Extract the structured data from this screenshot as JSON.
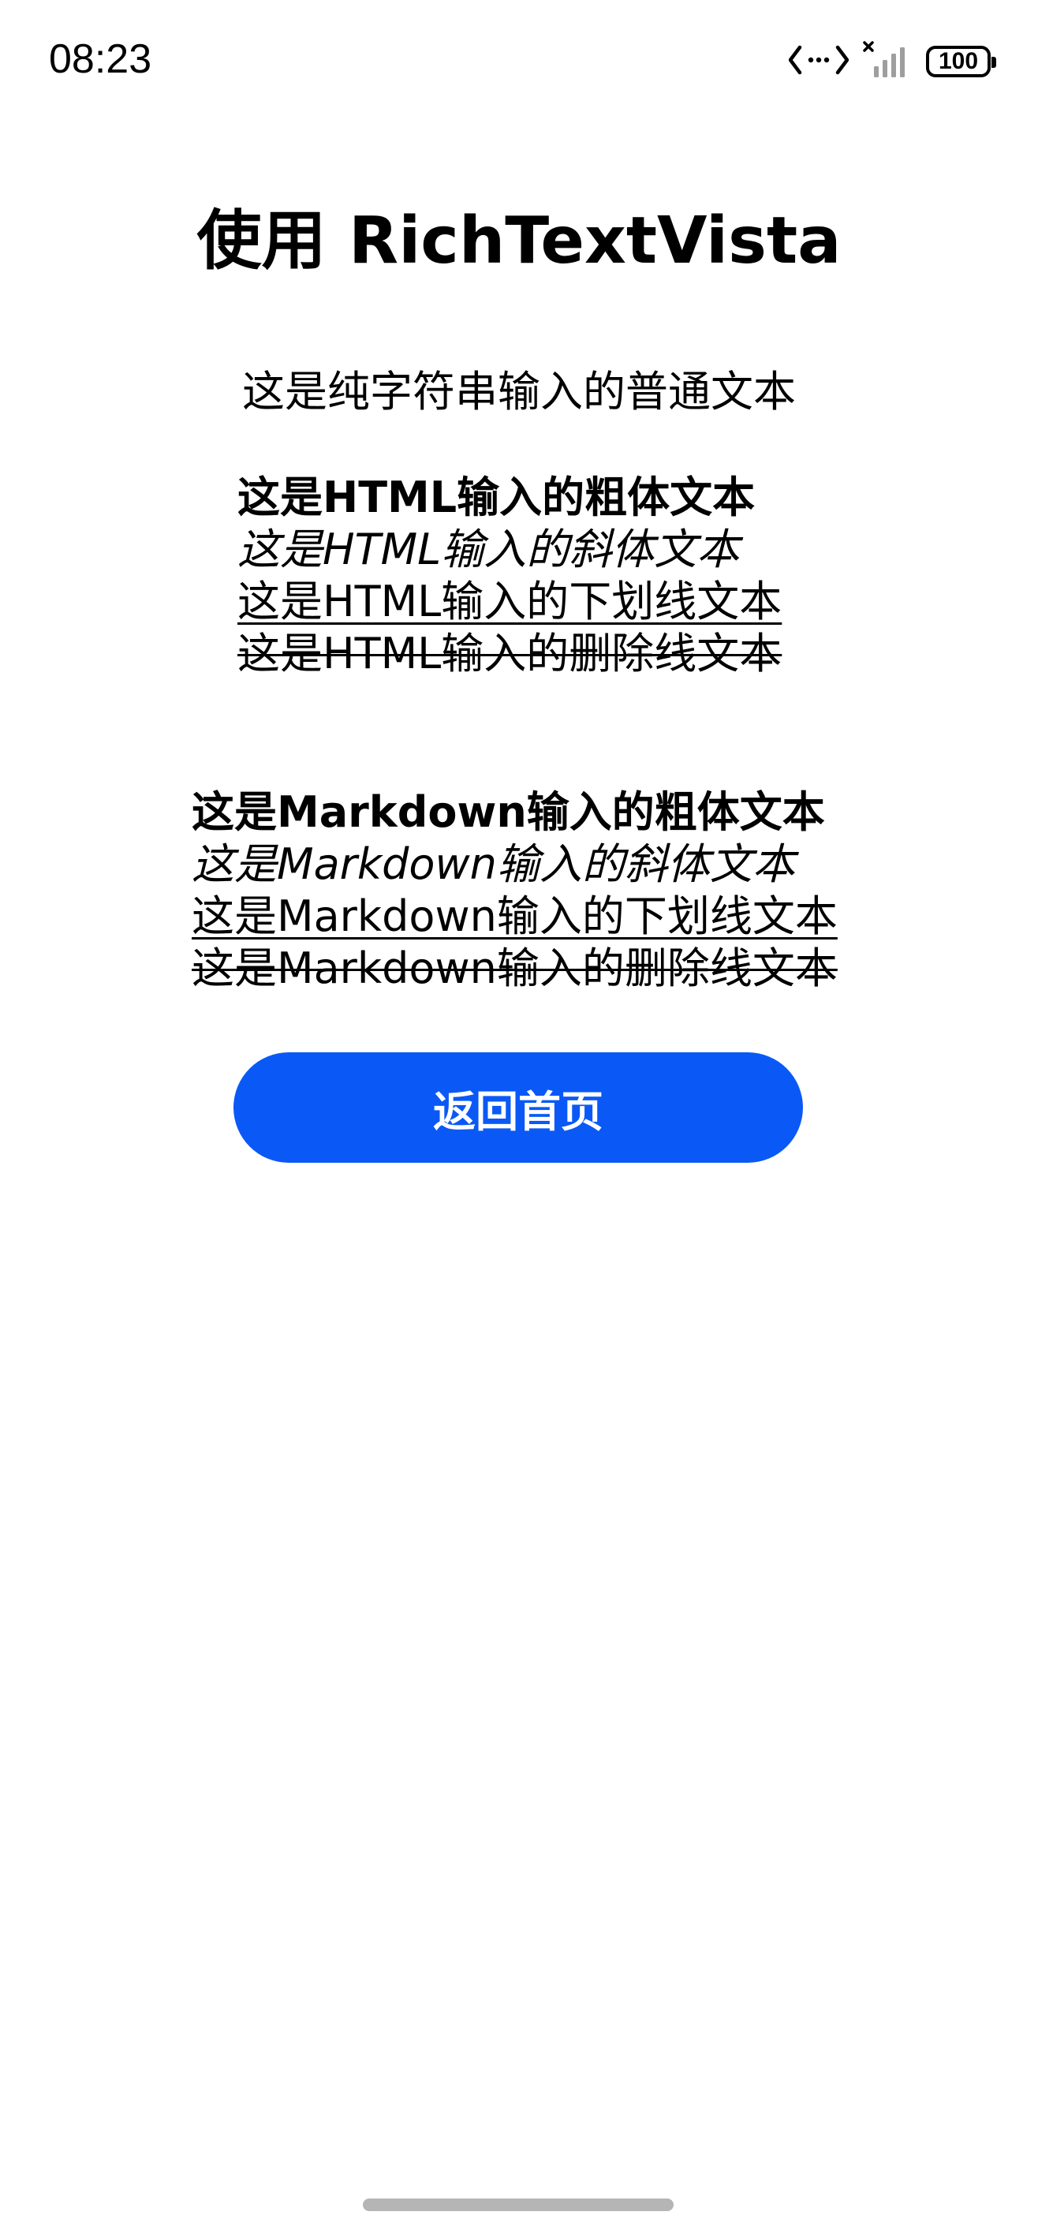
{
  "status_bar": {
    "time": "08:23",
    "battery_level": "100",
    "icons": [
      "data-transfer-icon",
      "no-sim-signal-icon",
      "battery-icon"
    ]
  },
  "page": {
    "title": "使用 RichTextVista",
    "plain_text": "这是纯字符串输入的普通文本",
    "html_lines": {
      "bold": "这是HTML输入的粗体文本",
      "italic": "这是HTML输入的斜体文本",
      "underline": "这是HTML输入的下划线文本",
      "strike": "这是HTML输入的删除线文本"
    },
    "markdown_lines": {
      "bold": "这是Markdown输入的粗体文本",
      "italic": "这是Markdown输入的斜体文本",
      "underline": "这是Markdown输入的下划线文本",
      "strike": "这是Markdown输入的删除线文本"
    },
    "home_button_label": "返回首页"
  },
  "colors": {
    "accent": "#0a59f7",
    "background": "#ffffff",
    "text": "#000000",
    "home_indicator": "#b5b5b5"
  }
}
